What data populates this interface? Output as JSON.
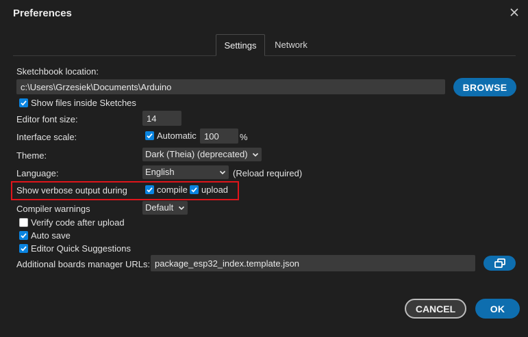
{
  "dialog": {
    "title": "Preferences"
  },
  "tabs": [
    {
      "label": "Settings",
      "active": true
    },
    {
      "label": "Network",
      "active": false
    }
  ],
  "sketchbook": {
    "label": "Sketchbook location:",
    "value": "c:\\Users\\Grzesiek\\Documents\\Arduino",
    "browse_label": "BROWSE",
    "show_files_label": "Show files inside Sketches",
    "show_files_checked": true
  },
  "font_size": {
    "label": "Editor font size:",
    "value": "14"
  },
  "interface_scale": {
    "label": "Interface scale:",
    "automatic_label": "Automatic",
    "automatic_checked": true,
    "value": "100",
    "unit": "%"
  },
  "theme": {
    "label": "Theme:",
    "value": "Dark (Theia) (deprecated)"
  },
  "language": {
    "label": "Language:",
    "value": "English",
    "note": "(Reload required)"
  },
  "verbose": {
    "label": "Show verbose output during",
    "compile_label": "compile",
    "compile_checked": true,
    "upload_label": "upload",
    "upload_checked": true
  },
  "compiler_warnings": {
    "label": "Compiler warnings",
    "value": "Default"
  },
  "options": {
    "verify_label": "Verify code after upload",
    "verify_checked": false,
    "autosave_label": "Auto save",
    "autosave_checked": true,
    "suggestions_label": "Editor Quick Suggestions",
    "suggestions_checked": true
  },
  "boards_urls": {
    "label": "Additional boards manager URLs:",
    "value": "package_esp32_index.template.json"
  },
  "footer": {
    "cancel_label": "CANCEL",
    "ok_label": "OK"
  },
  "colors": {
    "accent": "#0e6eaf",
    "checkbox": "#0a84e0",
    "highlight_box": "#e0151b",
    "background": "#1f1f1f",
    "field": "#3b3b3b"
  },
  "icons": {
    "close": "close-icon",
    "check": "check-icon",
    "chevron": "chevron-down-icon",
    "edit_urls": "open-window-icon"
  }
}
